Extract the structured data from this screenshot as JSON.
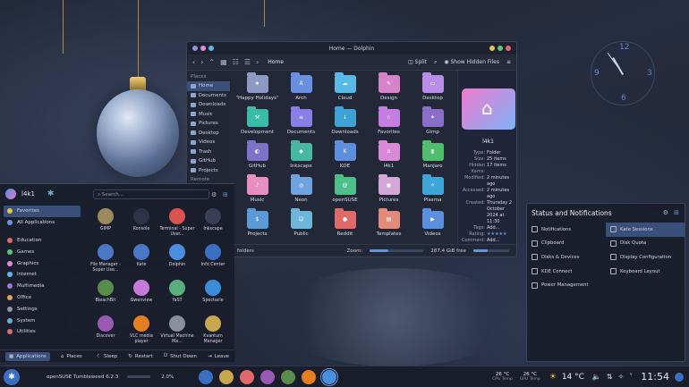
{
  "dolphin": {
    "title": "Home — Dolphin",
    "breadcrumb": "Home",
    "split_label": "Split",
    "hidden_label": "Show Hidden Files",
    "places_header": "Places",
    "remote_header": "Remote",
    "places": [
      "Home",
      "Documents",
      "Downloads",
      "Music",
      "Pictures",
      "Desktop",
      "Videos",
      "Trash",
      "GitHub",
      "Projects"
    ],
    "files": [
      {
        "name": "\"Happy Holidays\"",
        "color": "#8d9bc3",
        "glyph": "★"
      },
      {
        "name": "Arch",
        "color": "#6a8fe0",
        "glyph": "A"
      },
      {
        "name": "Cloud",
        "color": "#58b8e6",
        "glyph": "☁"
      },
      {
        "name": "Design",
        "color": "#d783c9",
        "glyph": "✎"
      },
      {
        "name": "Desktop",
        "color": "#b98ce8",
        "glyph": "▭"
      },
      {
        "name": "Development",
        "color": "#39bca8",
        "glyph": "⚒"
      },
      {
        "name": "Documents",
        "color": "#8b7fe6",
        "glyph": "≡"
      },
      {
        "name": "Downloads",
        "color": "#3fa2d6",
        "glyph": "↓"
      },
      {
        "name": "Favorites",
        "color": "#c27ee0",
        "glyph": "☆"
      },
      {
        "name": "Gimp",
        "color": "#8a6ec9",
        "glyph": "✦"
      },
      {
        "name": "GitHub",
        "color": "#7d71c8",
        "glyph": "◐"
      },
      {
        "name": "Inkscape",
        "color": "#49b8a2",
        "glyph": "◆"
      },
      {
        "name": "KDE",
        "color": "#5d8fdc",
        "glyph": "K"
      },
      {
        "name": "l4k1",
        "color": "#d88ad8",
        "glyph": "⌂"
      },
      {
        "name": "Manjaro",
        "color": "#4fbf6d",
        "glyph": "▮"
      },
      {
        "name": "Music",
        "color": "#e58fc3",
        "glyph": "♪"
      },
      {
        "name": "Neon",
        "color": "#6fa3df",
        "glyph": "◎"
      },
      {
        "name": "openSUSE",
        "color": "#4fbf8a",
        "glyph": "@"
      },
      {
        "name": "Pictures",
        "color": "#d4a8d6",
        "glyph": "▣"
      },
      {
        "name": "Plasma",
        "color": "#3fa6d8",
        "glyph": "✧"
      },
      {
        "name": "Projects",
        "color": "#5a9ad6",
        "glyph": "$"
      },
      {
        "name": "Public",
        "color": "#6db6d9",
        "glyph": "☺"
      },
      {
        "name": "Reddit",
        "color": "#e06a6a",
        "glyph": "●"
      },
      {
        "name": "Templates",
        "color": "#e28a7c",
        "glyph": "▤"
      },
      {
        "name": "Videos",
        "color": "#5b8fe0",
        "glyph": "▶"
      }
    ],
    "info": {
      "name": "l4k1",
      "rows": [
        {
          "k": "Type:",
          "v": "Folder"
        },
        {
          "k": "Size:",
          "v": "25 items"
        },
        {
          "k": "Hidden items:",
          "v": "17 items"
        },
        {
          "k": "Modified:",
          "v": "2 minutes ago"
        },
        {
          "k": "Accessed:",
          "v": "2 minutes ago"
        },
        {
          "k": "Created:",
          "v": "Thursday 2 October 2024 at 11:30"
        },
        {
          "k": "Tags:",
          "v": "Add..."
        },
        {
          "k": "Rating:",
          "v": "★★★★★"
        },
        {
          "k": "Comment:",
          "v": "Add..."
        }
      ]
    },
    "status": {
      "folders": "folders",
      "zoom_label": "Zoom:",
      "free": "287.4 GiB free",
      "zoom_level": 0.35,
      "free_level": 0.4
    }
  },
  "clock": {
    "twelve": "12",
    "three": "3",
    "six": "6",
    "nine": "9"
  },
  "launcher": {
    "user": "l4k1",
    "search_placeholder": "Search...",
    "categories": [
      {
        "label": "Favorites",
        "color": "#e6c24f"
      },
      {
        "label": "All Applications",
        "color": "#6a94d8"
      },
      {
        "label": "Education",
        "color": "#e06a6a"
      },
      {
        "label": "Games",
        "color": "#5cc77a"
      },
      {
        "label": "Graphics",
        "color": "#e08ad8"
      },
      {
        "label": "Internet",
        "color": "#58b8e6"
      },
      {
        "label": "Multimedia",
        "color": "#a07ae0"
      },
      {
        "label": "Office",
        "color": "#e6a24f"
      },
      {
        "label": "Settings",
        "color": "#8b94ab"
      },
      {
        "label": "System",
        "color": "#6ab0c8"
      },
      {
        "label": "Utilities",
        "color": "#d87070"
      }
    ],
    "apps": [
      {
        "name": "GIMP",
        "color": "#9c8a5c"
      },
      {
        "name": "Konsole",
        "color": "#2d3447"
      },
      {
        "name": "Terminal - Super User...",
        "color": "#d9534f"
      },
      {
        "name": "Inkscape",
        "color": "#3a3f55"
      },
      {
        "name": "File Manager - Super Use...",
        "color": "#4a78c8"
      },
      {
        "name": "Kate",
        "color": "#4a78c8"
      },
      {
        "name": "Dolphin",
        "color": "#4a8ee0"
      },
      {
        "name": "Info Center",
        "color": "#3b6fc4"
      },
      {
        "name": "BleachBit",
        "color": "#5a8c4c"
      },
      {
        "name": "Gwenview",
        "color": "#c47ad8"
      },
      {
        "name": "YaST",
        "color": "#5ab07c"
      },
      {
        "name": "Spectacle",
        "color": "#3a8ed8"
      },
      {
        "name": "Discover",
        "color": "#9b59b6"
      },
      {
        "name": "VLC media player",
        "color": "#e67e22"
      },
      {
        "name": "Virtual Machine Ma...",
        "color": "#8a8f9e"
      },
      {
        "name": "Kvantum Manager",
        "color": "#c9a74f"
      }
    ],
    "footer": {
      "applications": "Applications",
      "places": "Places",
      "sleep": "Sleep",
      "restart": "Restart",
      "shutdown": "Shut Down",
      "leave": "Leave"
    }
  },
  "status_notifications": {
    "title": "Status and Notifications",
    "left": [
      "Notifications",
      "Clipboard",
      "Disks & Devices",
      "KDE Connect",
      "Power Management"
    ],
    "right": [
      "Kate Sessions",
      "Disk Quota",
      "Display Configuration",
      "Keyboard Layout"
    ]
  },
  "taskbar": {
    "os_name": "openSUSE Tumbleweed 6.2.3",
    "cpu_percent": "2.0%",
    "tasks": [
      "#3b6fc4",
      "#c9a74f",
      "#e06a6a",
      "#9b59b6",
      "#5a8c4c",
      "#e67e22",
      "#4a8ee0"
    ],
    "cpu_temp": "26 °C",
    "cpu_temp_label": "CPU Temp",
    "gpu_temp": "26 °C",
    "gpu_temp_label": "GPU Temp",
    "weather": "14 °C",
    "time": "11:54"
  }
}
